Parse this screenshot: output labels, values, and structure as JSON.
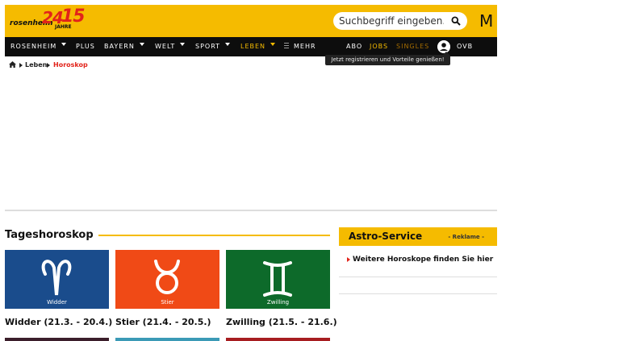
{
  "header": {
    "logo_text": "rosenheim",
    "logo_number": "24",
    "logo_anniversary": "15",
    "logo_jahre": "JAHRE",
    "search_placeholder": "Suchbegriff eingeben...",
    "m_logo": "M",
    "brand_color": "#f5bb00"
  },
  "nav": {
    "items": [
      {
        "label": "ROSENHEIM",
        "has_caret": true
      },
      {
        "label": "PLUS",
        "has_caret": false
      },
      {
        "label": "BAYERN",
        "has_caret": true
      },
      {
        "label": "WELT",
        "has_caret": true
      },
      {
        "label": "SPORT",
        "has_caret": true
      },
      {
        "label": "LEBEN",
        "has_caret": true,
        "active": true
      },
      {
        "label": "MEHR",
        "has_caret": false
      }
    ],
    "right": {
      "abo": "ABO",
      "jobs": "JOBS",
      "singles": "SINGLES",
      "ovb": "OVB MEDIA"
    },
    "tooltip": "Jetzt registrieren und Vorteile genießen!"
  },
  "breadcrumb": {
    "home_icon": "home-icon",
    "items": [
      "Leben",
      "Horoskop"
    ]
  },
  "main": {
    "section_title": "Tageshoroskop",
    "cards": [
      {
        "name": "Widder",
        "caption": "Widder (21.3. - 20.4.)",
        "color": "#1a4c8c",
        "bottom_color": "#3b1e2b"
      },
      {
        "name": "Stier",
        "caption": "Stier (21.4. - 20.5.)",
        "color": "#f04a16",
        "bottom_color": "#3b9ab6"
      },
      {
        "name": "Zwilling",
        "caption": "Zwilling (21.5. - 21.6.)",
        "color": "#0d6a2a",
        "bottom_color": "#a71d20"
      }
    ]
  },
  "sidebar": {
    "title": "Astro-Service",
    "reklame": "- Reklame -",
    "link": "Weitere Horoskope finden Sie hier"
  }
}
